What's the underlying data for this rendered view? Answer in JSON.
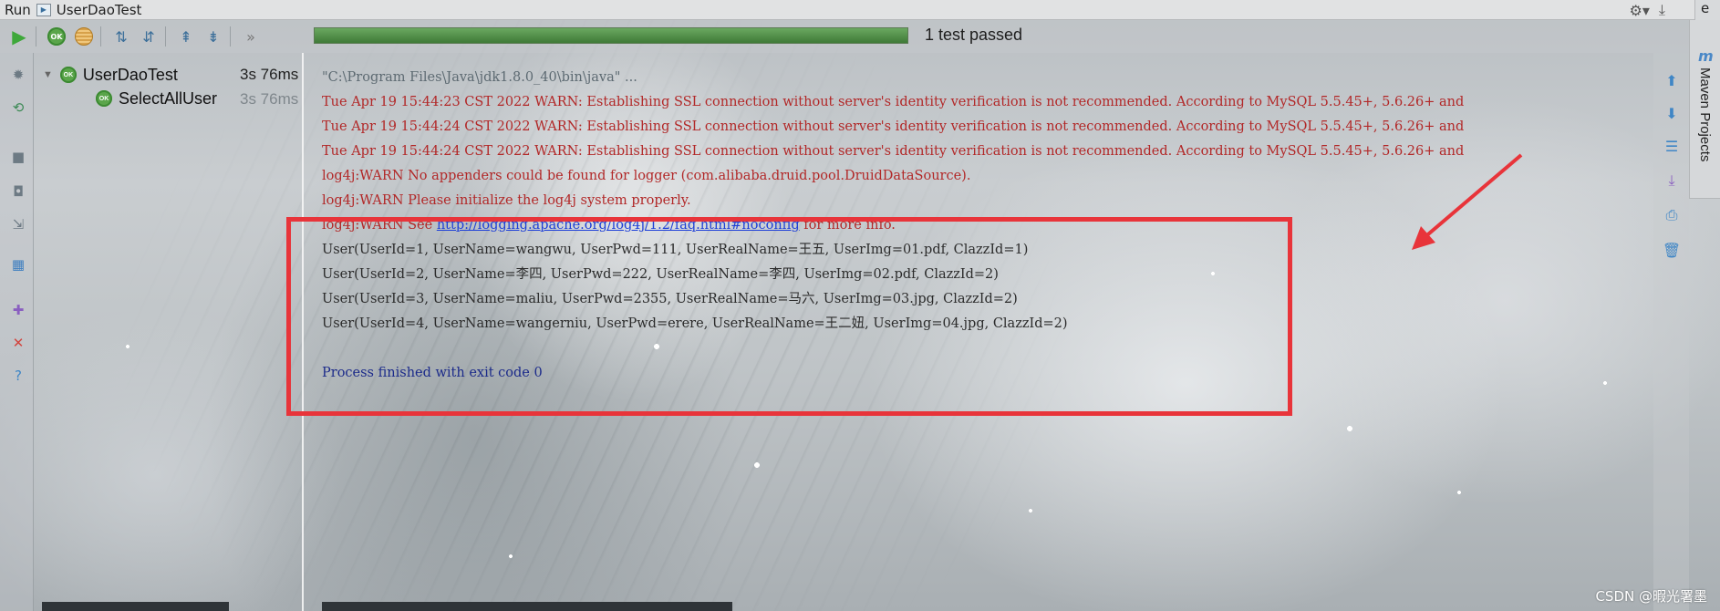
{
  "titlebar": {
    "run_label": "Run",
    "tab_title": "UserDaoTest",
    "right_edge_text": "e"
  },
  "toolbar": {
    "progress_fraction": 1.0,
    "status_text": "1 test passed",
    "colors": {
      "progress": "#4e8a45",
      "ok": "#5aa54a"
    }
  },
  "tree": {
    "root": {
      "label": "UserDaoTest",
      "time": "3s 76ms",
      "badge": "OK"
    },
    "child": {
      "label": "SelectAllUser",
      "time": "3s 76ms",
      "badge": "OK"
    }
  },
  "console": {
    "cmd": "\"C:\\Program Files\\Java\\jdk1.8.0_40\\bin\\java\" ...",
    "warn1": "Tue Apr 19 15:44:23 CST 2022 WARN: Establishing SSL connection without server's identity verification is not recommended. According to MySQL 5.5.45+, 5.6.26+ and",
    "warn2": "Tue Apr 19 15:44:24 CST 2022 WARN: Establishing SSL connection without server's identity verification is not recommended. According to MySQL 5.5.45+, 5.6.26+ and",
    "warn3": "Tue Apr 19 15:44:24 CST 2022 WARN: Establishing SSL connection without server's identity verification is not recommended. According to MySQL 5.5.45+, 5.6.26+ and",
    "log1": "log4j:WARN No appenders could be found for logger (com.alibaba.druid.pool.DruidDataSource).",
    "log2": "log4j:WARN Please initialize the log4j system properly.",
    "log3_prefix": "log4j:WARN See ",
    "log3_link": "http://logging.apache.org/log4j/1.2/faq.html#noconfig",
    "log3_suffix": " for more info.",
    "user1": "User(UserId=1, UserName=wangwu, UserPwd=111, UserRealName=王五, UserImg=01.pdf, ClazzId=1)",
    "user2": "User(UserId=2, UserName=李四, UserPwd=222, UserRealName=李四, UserImg=02.pdf, ClazzId=2)",
    "user3": "User(UserId=3, UserName=maliu, UserPwd=2355, UserRealName=马六, UserImg=03.jpg, ClazzId=2)",
    "user4": "User(UserId=4, UserName=wangerniu, UserPwd=erere, UserRealName=王二妞, UserImg=04.jpg, ClazzId=2)",
    "exit": "Process finished with exit code 0"
  },
  "maven_tab": {
    "label": "Maven Projects",
    "logo": "m"
  },
  "watermark": "CSDN @暇光署墨",
  "annotation_colors": {
    "highlight_box": "#e8343a",
    "arrow": "#e8343a"
  },
  "icons": {
    "toolbar": [
      "run-icon",
      "ok-filter-icon",
      "ignored-filter-icon",
      "sort-alpha-icon",
      "sort-duration-icon",
      "expand-all-icon",
      "collapse-all-icon",
      "more-icon"
    ],
    "left_strip": [
      "debug-icon",
      "rerun-failed-icon",
      "stop-icon",
      "camera-icon",
      "export-icon",
      "layout-icon",
      "pin-icon",
      "close-icon",
      "help-icon"
    ],
    "right_strip": [
      "up-arrow-icon",
      "down-arrow-icon",
      "soft-wrap-icon",
      "scroll-to-end-icon",
      "print-icon",
      "trash-icon"
    ]
  }
}
